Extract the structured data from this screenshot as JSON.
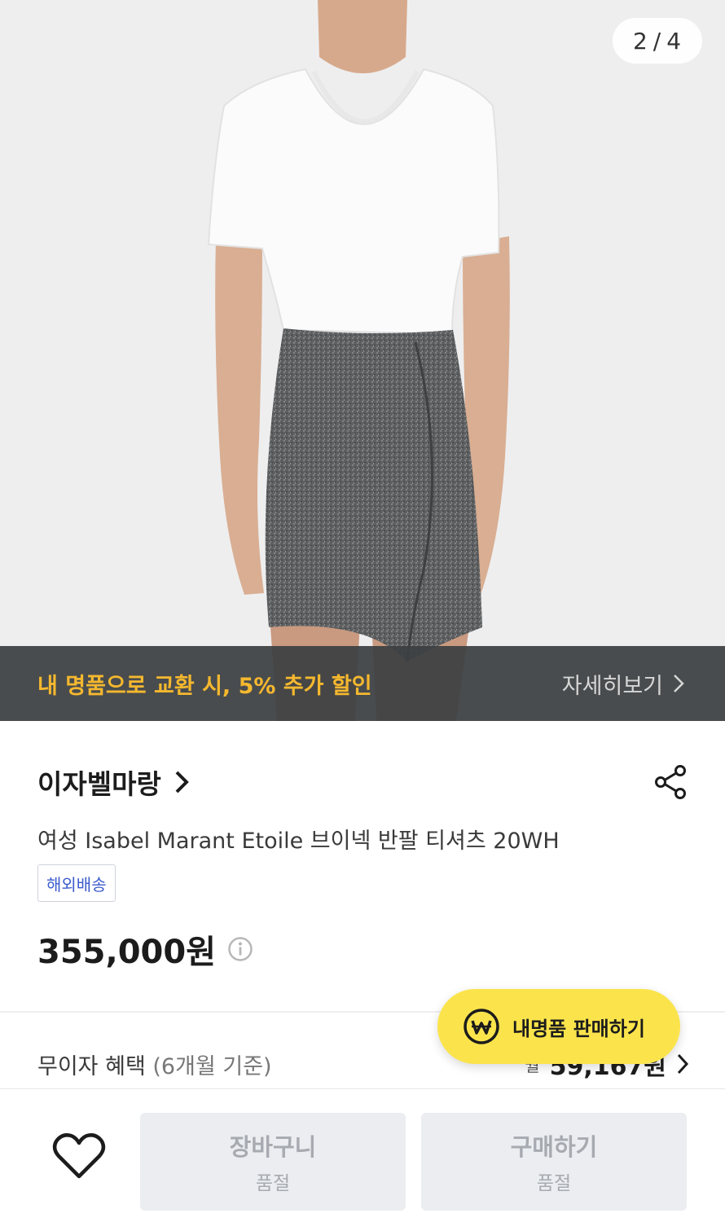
{
  "gallery": {
    "current_page": "2",
    "separator": "/",
    "total_pages": "4"
  },
  "promo": {
    "text": "내 명품으로 교환 시, 5% 추가 할인",
    "more_label": "자세히보기"
  },
  "product": {
    "brand": "이자벨마랑",
    "title": "여성 Isabel Marant Etoile 브이넥 반팔 티셔츠 20WH",
    "tag": "해외배송",
    "price": "355,000원"
  },
  "benefit": {
    "label": "무이자 혜택",
    "label_sub": "(6개월 기준)",
    "value_prefix": "월",
    "value": "59,167원"
  },
  "sell_button": {
    "label": "내명품 판매하기"
  },
  "bottom_bar": {
    "cart_label": "장바구니",
    "cart_status": "품절",
    "buy_label": "구매하기",
    "buy_status": "품절"
  },
  "colors": {
    "promo_accent": "#f5b82e",
    "sell_button_bg": "#fbe44b",
    "tag_text": "#3b5bcc",
    "disabled_button_bg": "#ebedf0"
  },
  "icons": [
    "share-icon",
    "chevron-right-icon",
    "info-icon",
    "won-coin-icon",
    "heart-icon"
  ]
}
